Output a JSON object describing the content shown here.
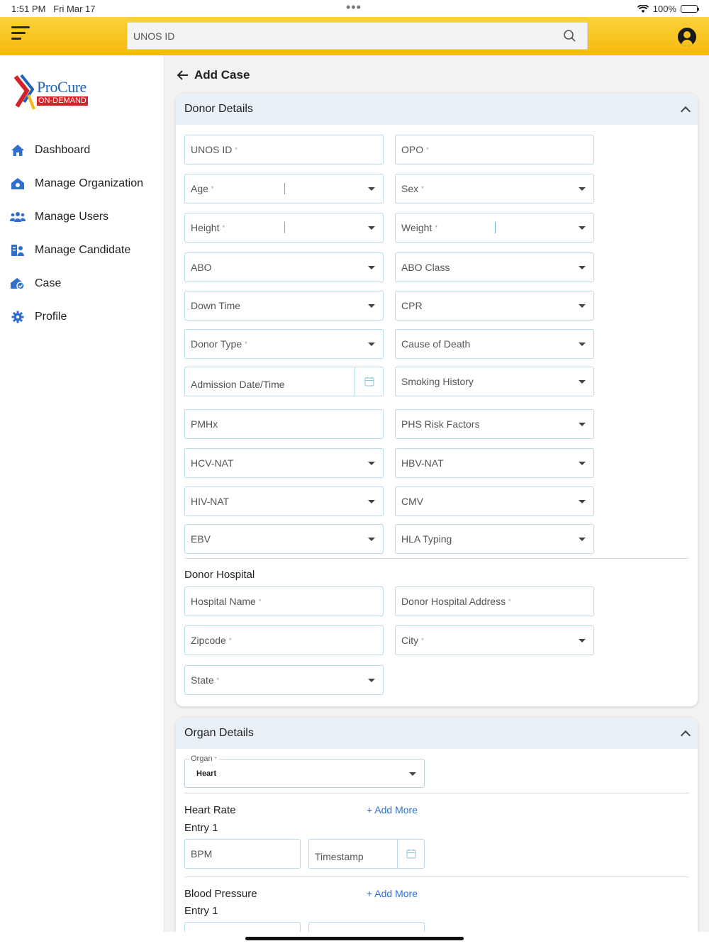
{
  "status": {
    "time": "1:51 PM",
    "date": "Fri Mar 17",
    "battery": "100%"
  },
  "search": {
    "placeholder": "UNOS ID"
  },
  "logo": {
    "brand": "ProCure",
    "sub": "ON-DEMAND"
  },
  "nav": [
    {
      "label": "Dashboard",
      "icon": "home-icon"
    },
    {
      "label": "Manage Organization",
      "icon": "organization-icon"
    },
    {
      "label": "Manage Users",
      "icon": "users-icon"
    },
    {
      "label": "Manage Candidate",
      "icon": "candidate-icon"
    },
    {
      "label": "Case",
      "icon": "case-icon"
    },
    {
      "label": "Profile",
      "icon": "gear-icon"
    }
  ],
  "page": {
    "title": "Add Case"
  },
  "donor": {
    "title": "Donor Details",
    "fields": {
      "unos_id": "UNOS ID",
      "opo": "OPO",
      "age": "Age",
      "sex": "Sex",
      "height": "Height",
      "weight": "Weight",
      "abo": "ABO",
      "abo_class": "ABO Class",
      "down_time": "Down Time",
      "cpr": "CPR",
      "donor_type": "Donor Type",
      "cause_of_death": "Cause of Death",
      "admission": "Admission Date/Time",
      "smoking": "Smoking History",
      "pmhx": "PMHx",
      "phs": "PHS Risk Factors",
      "hcv": "HCV-NAT",
      "hbv": "HBV-NAT",
      "hiv": "HIV-NAT",
      "cmv": "CMV",
      "ebv": "EBV",
      "hla": "HLA Typing"
    },
    "required_mark": "*",
    "hospital": {
      "title": "Donor Hospital",
      "name": "Hospital Name",
      "address": "Donor Hospital Address",
      "zipcode": "Zipcode",
      "city": "City",
      "state": "State"
    }
  },
  "organ": {
    "title": "Organ Details",
    "organ_label": "Organ",
    "organ_value": "Heart",
    "heart_rate": {
      "title": "Heart Rate",
      "add_more": "+ Add More",
      "entry": "Entry 1",
      "bpm": "BPM",
      "timestamp": "Timestamp"
    },
    "blood_pressure": {
      "title": "Blood Pressure",
      "add_more": "+ Add More",
      "entry": "Entry 1"
    }
  },
  "colors": {
    "accent": "#f5b90d",
    "link": "#2b6fd1",
    "header_bg": "#e8f0f8"
  }
}
